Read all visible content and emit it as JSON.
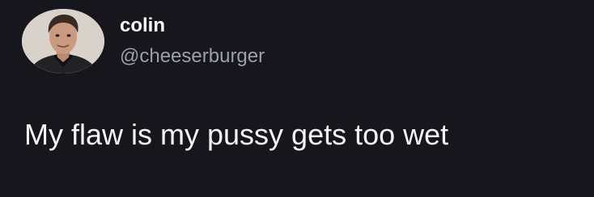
{
  "tweet": {
    "author": {
      "display_name": "colin",
      "handle": "@cheeserburger",
      "avatar_icon": "profile-photo"
    },
    "text": "My flaw is my pussy gets too wet"
  },
  "colors": {
    "background": "#17161d",
    "name_text": "#ffffff",
    "handle_text": "#9aa0a8",
    "body_text": "#f4f4f6"
  }
}
